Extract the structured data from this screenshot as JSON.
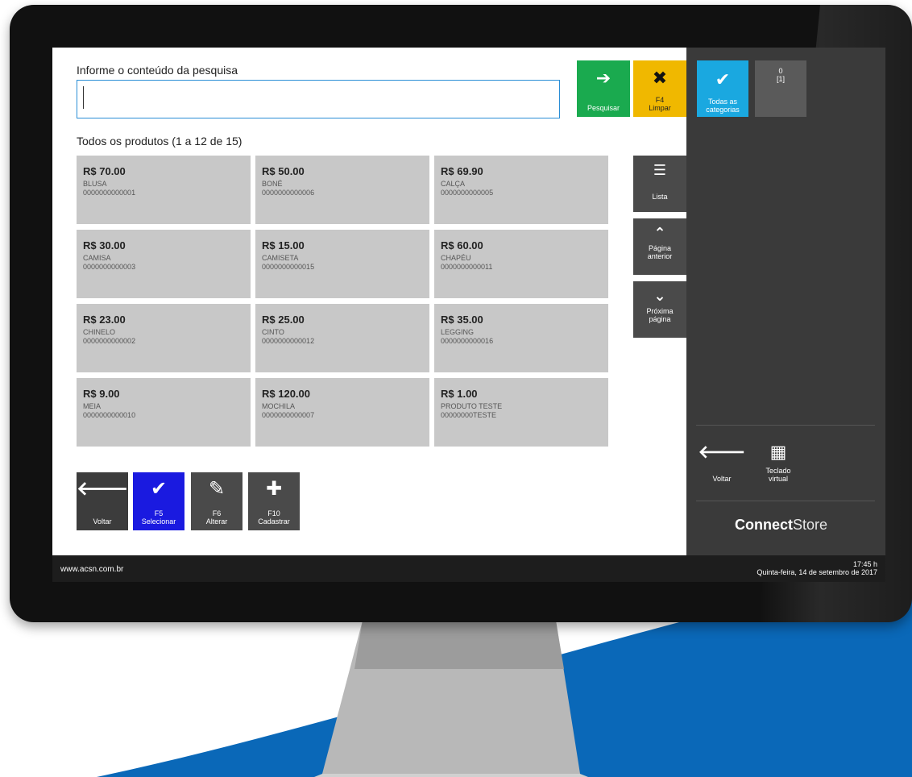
{
  "search": {
    "label": "Informe o conteúdo da pesquisa",
    "value": "",
    "search_button": "Pesquisar",
    "clear_key": "F4",
    "clear_label": "Limpar"
  },
  "products": {
    "title": "Todos os produtos (1 a 12 de 15)",
    "items": [
      {
        "price": "R$ 70.00",
        "name": "BLUSA",
        "code": "0000000000001"
      },
      {
        "price": "R$ 50.00",
        "name": "BONÉ",
        "code": "0000000000006"
      },
      {
        "price": "R$ 69.90",
        "name": "CALÇA",
        "code": "0000000000005"
      },
      {
        "price": "R$ 30.00",
        "name": "CAMISA",
        "code": "0000000000003"
      },
      {
        "price": "R$ 15.00",
        "name": "CAMISETA",
        "code": "0000000000015"
      },
      {
        "price": "R$ 60.00",
        "name": "CHAPÉU",
        "code": "0000000000011"
      },
      {
        "price": "R$ 23.00",
        "name": "CHINELO",
        "code": "0000000000002"
      },
      {
        "price": "R$ 25.00",
        "name": "CINTO",
        "code": "0000000000012"
      },
      {
        "price": "R$ 35.00",
        "name": "LEGGING",
        "code": "0000000000016"
      },
      {
        "price": "R$ 9.00",
        "name": "MEIA",
        "code": "0000000000010"
      },
      {
        "price": "R$ 120.00",
        "name": "MOCHILA",
        "code": "0000000000007"
      },
      {
        "price": "R$ 1.00",
        "name": "PRODUTO TESTE",
        "code": "00000000TESTE"
      }
    ]
  },
  "nav": {
    "list": "Lista",
    "prev_line1": "Página",
    "prev_line2": "anterior",
    "next_line1": "Próxima",
    "next_line2": "página"
  },
  "actions": {
    "back": "Voltar",
    "select_key": "F5",
    "select": "Selecionar",
    "edit_key": "F6",
    "edit": "Alterar",
    "create_key": "F10",
    "create": "Cadastrar"
  },
  "side": {
    "all_categories_line1": "Todas as",
    "all_categories_line2": "categorias",
    "other_category_line1": "0",
    "other_category_line2": "[1]",
    "back": "Voltar",
    "keyboard_line1": "Teclado",
    "keyboard_line2": "virtual",
    "brand_bold": "Connect",
    "brand_light": "Store"
  },
  "status": {
    "url": "www.acsn.com.br",
    "time": "17:45 h",
    "date": "Quinta-feira, 14 de setembro de 2017"
  },
  "colors": {
    "search_green": "#1aaa4f",
    "clear_yellow": "#f0b800",
    "select_blue": "#1a1ae0",
    "category_cyan": "#1aa8e0",
    "tile_gray": "#c8c8c8",
    "panel_dark": "#3a3a3a"
  }
}
